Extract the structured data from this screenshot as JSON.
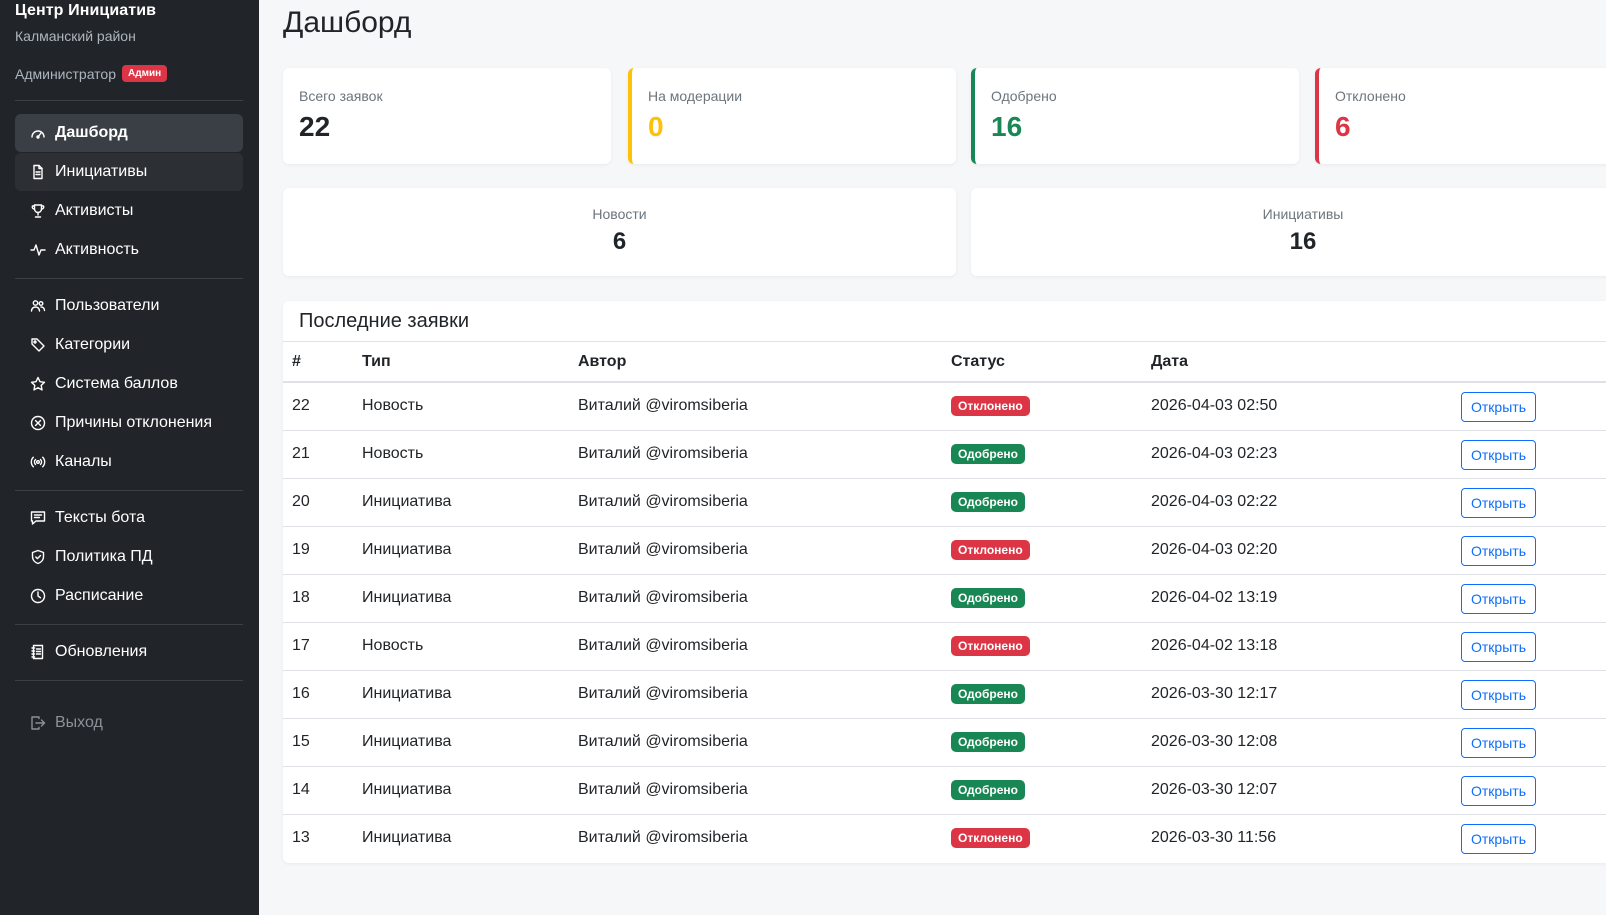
{
  "sidebar": {
    "brand_title": "Центр Инициатив",
    "brand_subtitle": "Калманский район",
    "user_role": "Администратор",
    "user_badge": "Админ",
    "groups": [
      [
        {
          "label": "Дашборд",
          "icon": "speedometer-icon",
          "state": "active"
        },
        {
          "label": "Инициативы",
          "icon": "document-icon",
          "state": "hovered"
        },
        {
          "label": "Активисты",
          "icon": "trophy-icon",
          "state": ""
        },
        {
          "label": "Активность",
          "icon": "activity-icon",
          "state": ""
        }
      ],
      [
        {
          "label": "Пользователи",
          "icon": "people-icon",
          "state": ""
        },
        {
          "label": "Категории",
          "icon": "tags-icon",
          "state": ""
        },
        {
          "label": "Система баллов",
          "icon": "star-icon",
          "state": ""
        },
        {
          "label": "Причины отклонения",
          "icon": "x-circle-icon",
          "state": ""
        },
        {
          "label": "Каналы",
          "icon": "broadcast-icon",
          "state": ""
        }
      ],
      [
        {
          "label": "Тексты бота",
          "icon": "chat-text-icon",
          "state": ""
        },
        {
          "label": "Политика ПД",
          "icon": "shield-icon",
          "state": ""
        },
        {
          "label": "Расписание",
          "icon": "clock-icon",
          "state": ""
        }
      ],
      [
        {
          "label": "Обновления",
          "icon": "journal-icon",
          "state": ""
        }
      ],
      [
        {
          "label": "Выход",
          "icon": "logout-icon",
          "state": "muted"
        }
      ]
    ]
  },
  "main": {
    "title": "Дашборд",
    "stats": [
      {
        "label": "Всего заявок",
        "value": "22",
        "color": "#212529",
        "accent": ""
      },
      {
        "label": "На модерации",
        "value": "0",
        "color": "#ffc107",
        "accent": "warning"
      },
      {
        "label": "Одобрено",
        "value": "16",
        "color": "#198754",
        "accent": "success"
      },
      {
        "label": "Отклонено",
        "value": "6",
        "color": "#dc3545",
        "accent": "danger"
      }
    ],
    "counts": [
      {
        "label": "Новости",
        "value": "6"
      },
      {
        "label": "Инициативы",
        "value": "16"
      }
    ],
    "recent": {
      "title": "Последние заявки",
      "columns": [
        "#",
        "Тип",
        "Автор",
        "Статус",
        "Дата",
        ""
      ],
      "open_label": "Открыть",
      "rows": [
        {
          "id": "22",
          "type": "Новость",
          "author": "Виталий @viromsiberia",
          "status": "Отклонено",
          "kind": "danger",
          "date": "2026-04-03 02:50"
        },
        {
          "id": "21",
          "type": "Новость",
          "author": "Виталий @viromsiberia",
          "status": "Одобрено",
          "kind": "success",
          "date": "2026-04-03 02:23"
        },
        {
          "id": "20",
          "type": "Инициатива",
          "author": "Виталий @viromsiberia",
          "status": "Одобрено",
          "kind": "success",
          "date": "2026-04-03 02:22"
        },
        {
          "id": "19",
          "type": "Инициатива",
          "author": "Виталий @viromsiberia",
          "status": "Отклонено",
          "kind": "danger",
          "date": "2026-04-03 02:20"
        },
        {
          "id": "18",
          "type": "Инициатива",
          "author": "Виталий @viromsiberia",
          "status": "Одобрено",
          "kind": "success",
          "date": "2026-04-02 13:19"
        },
        {
          "id": "17",
          "type": "Новость",
          "author": "Виталий @viromsiberia",
          "status": "Отклонено",
          "kind": "danger",
          "date": "2026-04-02 13:18"
        },
        {
          "id": "16",
          "type": "Инициатива",
          "author": "Виталий @viromsiberia",
          "status": "Одобрено",
          "kind": "success",
          "date": "2026-03-30 12:17"
        },
        {
          "id": "15",
          "type": "Инициатива",
          "author": "Виталий @viromsiberia",
          "status": "Одобрено",
          "kind": "success",
          "date": "2026-03-30 12:08"
        },
        {
          "id": "14",
          "type": "Инициатива",
          "author": "Виталий @viromsiberia",
          "status": "Одобрено",
          "kind": "success",
          "date": "2026-03-30 12:07"
        },
        {
          "id": "13",
          "type": "Инициатива",
          "author": "Виталий @viromsiberia",
          "status": "Отклонено",
          "kind": "danger",
          "date": "2026-03-30 11:56"
        }
      ]
    }
  }
}
